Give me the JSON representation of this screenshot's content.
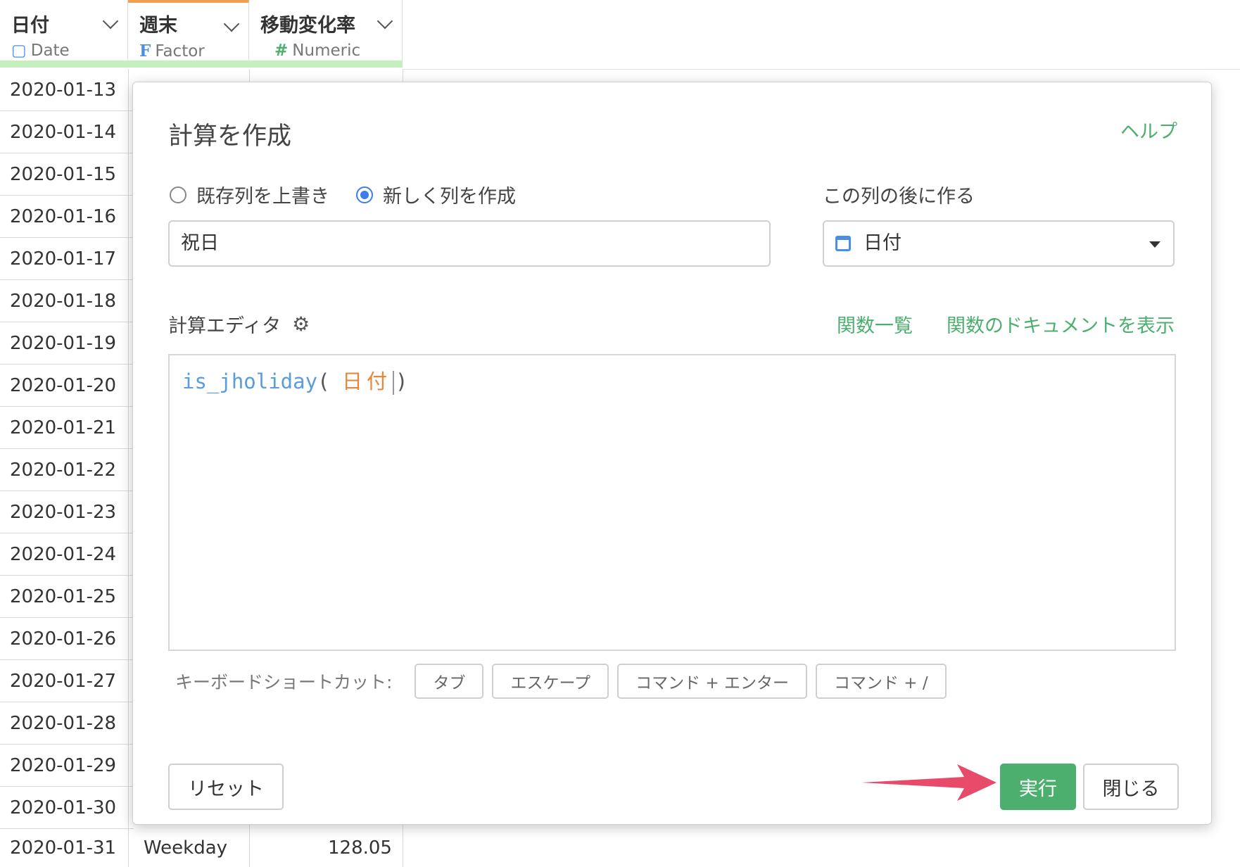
{
  "table": {
    "columns": [
      {
        "name": "日付",
        "type": "Date",
        "icon": "calendar-icon"
      },
      {
        "name": "週末",
        "type": "Factor",
        "icon": "factor-icon"
      },
      {
        "name": "移動変化率",
        "type": "Numeric",
        "icon": "hash-icon"
      }
    ],
    "dates": [
      "2020-01-13",
      "2020-01-14",
      "2020-01-15",
      "2020-01-16",
      "2020-01-17",
      "2020-01-18",
      "2020-01-19",
      "2020-01-20",
      "2020-01-21",
      "2020-01-22",
      "2020-01-23",
      "2020-01-24",
      "2020-01-25",
      "2020-01-26",
      "2020-01-27",
      "2020-01-28",
      "2020-01-29",
      "2020-01-30"
    ],
    "last_row": {
      "date": "2020-01-31",
      "weekend": "Weekday",
      "rate": "128.05"
    }
  },
  "modal": {
    "title": "計算を作成",
    "help": "ヘルプ",
    "radio_overwrite": "既存列を上書き",
    "radio_new": "新しく列を作成",
    "after_label": "この列の後に作る",
    "new_column_name": "祝日",
    "after_column": "日付",
    "editor_label": "計算エディタ",
    "fn_list": "関数一覧",
    "fn_docs": "関数のドキュメントを表示",
    "code": {
      "fn": "is_jholiday",
      "open": "(",
      "arg": "日付",
      "close": ")"
    },
    "shortcuts_label": "キーボードショートカット:",
    "shortcuts": [
      "タブ",
      "エスケープ",
      "コマンド + エンター",
      "コマンド + /"
    ],
    "reset": "リセット",
    "run": "実行",
    "close": "閉じる"
  },
  "colors": {
    "accent_green": "#4caf6e",
    "radio_blue": "#3d7de8",
    "arrow": "#e84a6a",
    "factor_orange": "#f0a050"
  }
}
